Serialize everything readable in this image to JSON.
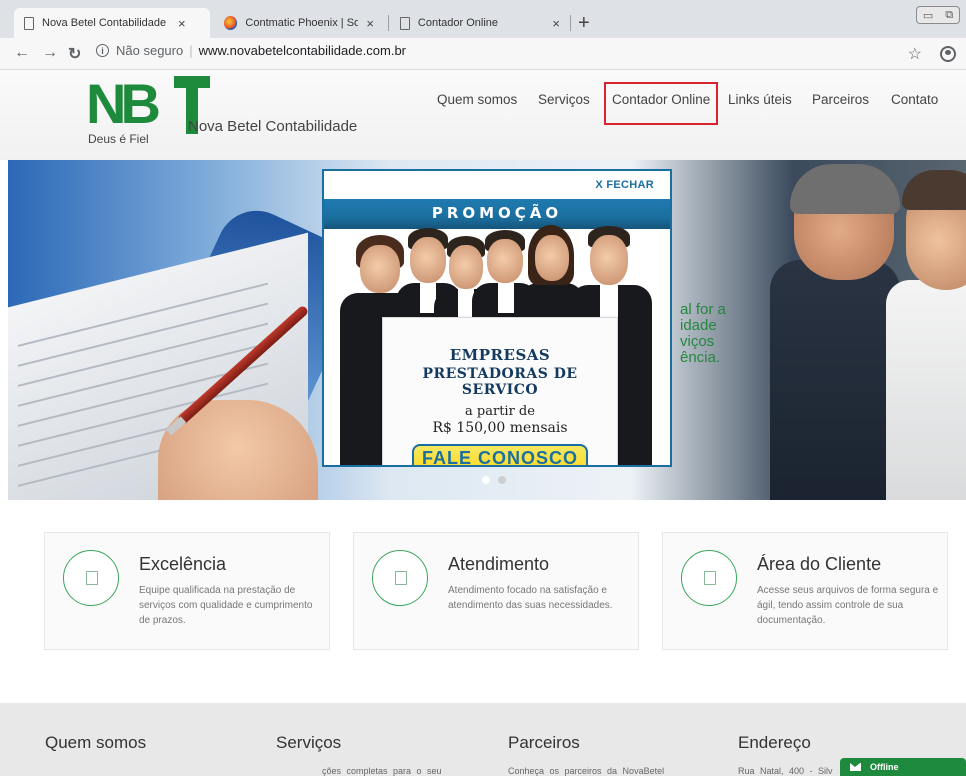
{
  "browser": {
    "tabs": [
      {
        "title": "Nova Betel Contabilidade",
        "close": "×"
      },
      {
        "title": "Contmatic Phoenix | Soluções em S",
        "close": "×"
      },
      {
        "title": "Contador Online",
        "close": "×"
      }
    ],
    "new_tab": "+",
    "address": {
      "security_label": "Não seguro",
      "url": "www.novabetelcontabilidade.com.br"
    }
  },
  "site": {
    "logo": {
      "letters_nb": "NB",
      "motto": "Deus é Fiel",
      "brand": "Nova Betel Contabilidade"
    },
    "nav": [
      {
        "label": "Quem somos"
      },
      {
        "label": "Serviços"
      },
      {
        "label": "Contador Online"
      },
      {
        "label": "Links úteis"
      },
      {
        "label": "Parceiros"
      },
      {
        "label": "Contato"
      }
    ]
  },
  "hero": {
    "background_text": [
      "al for a",
      "idade",
      "viços",
      "ência."
    ]
  },
  "popup": {
    "close_label": "X FECHAR",
    "banner": "PROMOÇÃO",
    "sign_line1": "EMPRESAS",
    "sign_line2": "PRESTADORAS DE SERVICO",
    "sign_line3": "a partir de",
    "sign_line4": "R$ 150,00 mensais",
    "cta": "FALE CONOSCO"
  },
  "features": [
    {
      "title": "Excelência",
      "description": "Equipe qualificada na prestação de serviços com qualidade e cumprimento de prazos."
    },
    {
      "title": "Atendimento",
      "description": "Atendimento focado na satisfação e atendimento das suas necessidades."
    },
    {
      "title": "Área do Cliente",
      "description": "Acesse seus arquivos de forma segura e ágil, tendo assim controle de sua documentação."
    }
  ],
  "footer": {
    "columns": [
      {
        "heading": "Quem somos",
        "text": ""
      },
      {
        "heading": "Serviços",
        "text": "ções completas para o seu"
      },
      {
        "heading": "Parceiros",
        "text": "Conheça os parceiros da NovaBetel"
      },
      {
        "heading": "Endereço",
        "text": "Rua Natal, 400 - Silv"
      }
    ]
  },
  "chat": {
    "label": "Offline"
  },
  "colors": {
    "brand_green": "#1d8a3c",
    "highlight_red": "#d9232e",
    "popup_blue": "#1b6fa0"
  }
}
